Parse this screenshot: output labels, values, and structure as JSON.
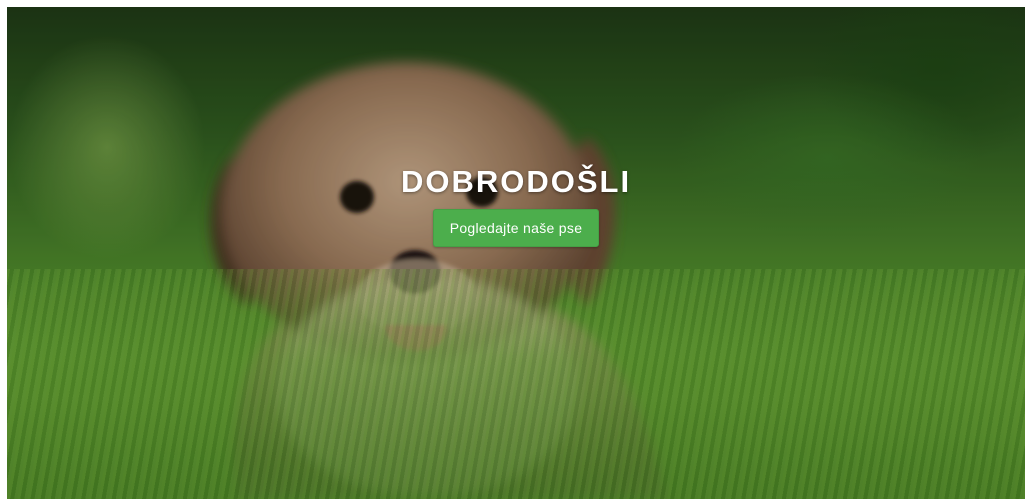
{
  "hero": {
    "title": "DOBRODOŠLI",
    "button_label": "Pogledajte naše pse",
    "button_color": "#4cae4c",
    "background_image": "puppy-on-grass"
  }
}
